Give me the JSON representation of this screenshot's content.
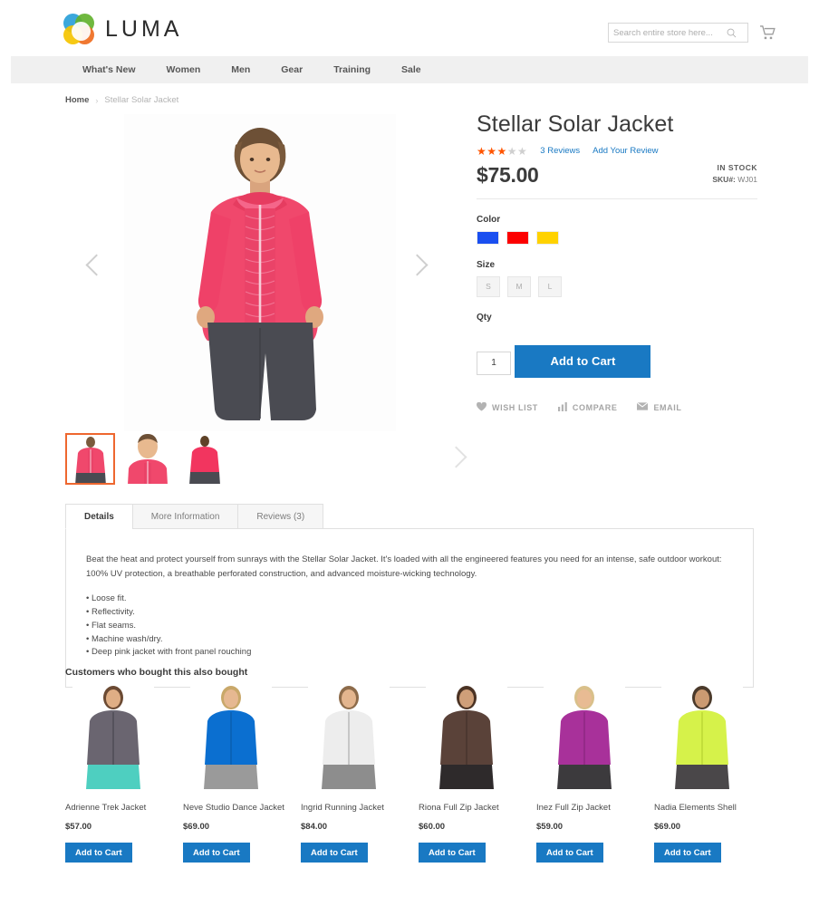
{
  "header": {
    "logo_text": "LUMA",
    "logo_icon": "luma-flower-logo",
    "search": {
      "placeholder": "Search entire store here...",
      "value": "",
      "icon": "search-icon"
    },
    "cart_icon": "shopping-cart-icon"
  },
  "nav": {
    "items": [
      {
        "label": "What's New"
      },
      {
        "label": "Women"
      },
      {
        "label": "Men"
      },
      {
        "label": "Gear"
      },
      {
        "label": "Training"
      },
      {
        "label": "Sale"
      }
    ]
  },
  "breadcrumb": {
    "home": "Home",
    "separator": "›",
    "current": "Stellar Solar Jacket"
  },
  "gallery": {
    "prev_icon": "chevron-left-icon",
    "next_icon": "chevron-right-icon",
    "thumbs_next_icon": "chevron-right-icon",
    "thumbnails": [
      {
        "alt": "Stellar Solar Jacket front view",
        "selected": true
      },
      {
        "alt": "Stellar Solar Jacket closeup view",
        "selected": false
      },
      {
        "alt": "Stellar Solar Jacket back view",
        "selected": false
      }
    ]
  },
  "product": {
    "title": "Stellar Solar Jacket",
    "rating_stars_filled": 3,
    "rating_stars_total": 5,
    "reviews_link": "3 Reviews",
    "add_review_link": "Add Your Review",
    "price": "$75.00",
    "availability": "IN STOCK",
    "sku_label": "SKU#:",
    "sku_value": "WJ01",
    "color_label": "Color",
    "colors": [
      {
        "name": "blue",
        "hex": "#1a4ff0"
      },
      {
        "name": "red",
        "hex": "#fc0000"
      },
      {
        "name": "yellow",
        "hex": "#ffd200"
      }
    ],
    "size_label": "Size",
    "sizes": [
      {
        "label": "S"
      },
      {
        "label": "M"
      },
      {
        "label": "L"
      }
    ],
    "qty_label": "Qty",
    "qty_value": "1",
    "add_to_cart": "Add to Cart",
    "actions": [
      {
        "label": "WISH LIST",
        "icon": "heart-icon"
      },
      {
        "label": "COMPARE",
        "icon": "bar-chart-icon"
      },
      {
        "label": "EMAIL",
        "icon": "envelope-icon"
      }
    ]
  },
  "tabs": {
    "items": [
      {
        "label": "Details",
        "active": true
      },
      {
        "label": "More Information",
        "active": false
      },
      {
        "label": "Reviews (3)",
        "active": false
      }
    ],
    "details": {
      "paragraph": "Beat the heat and protect yourself from sunrays with the Stellar Solar Jacket. It's loaded with all the engineered features you need for an intense, safe outdoor workout: 100% UV protection, a breathable perforated construction, and advanced moisture-wicking technology.",
      "bullets": [
        "• Loose fit.",
        "• Reflectivity.",
        "• Flat seams.",
        "• Machine wash/dry.",
        "• Deep pink jacket with front panel rouching"
      ]
    }
  },
  "related": {
    "title": "Customers who bought this also bought",
    "add_to_cart_label": "Add to Cart",
    "items": [
      {
        "name": "Adrienne Trek Jacket",
        "price": "$57.00",
        "jacket_color": "#6a6570",
        "pants_color": "#4ecfc0"
      },
      {
        "name": "Neve Studio Dance Jacket",
        "price": "$69.00",
        "jacket_color": "#0b6fd0",
        "pants_color": "#9a9a9a"
      },
      {
        "name": "Ingrid Running Jacket",
        "price": "$84.00",
        "jacket_color": "#ededed",
        "pants_color": "#8d8d8d"
      },
      {
        "name": "Riona Full Zip Jacket",
        "price": "$60.00",
        "jacket_color": "#5a4239",
        "pants_color": "#2e2a2b"
      },
      {
        "name": "Inez Full Zip Jacket",
        "price": "$59.00",
        "jacket_color": "#a8319a",
        "pants_color": "#3c3a3d"
      },
      {
        "name": "Nadia Elements Shell",
        "price": "$69.00",
        "jacket_color": "#d6f24a",
        "pants_color": "#4a4749"
      }
    ]
  }
}
